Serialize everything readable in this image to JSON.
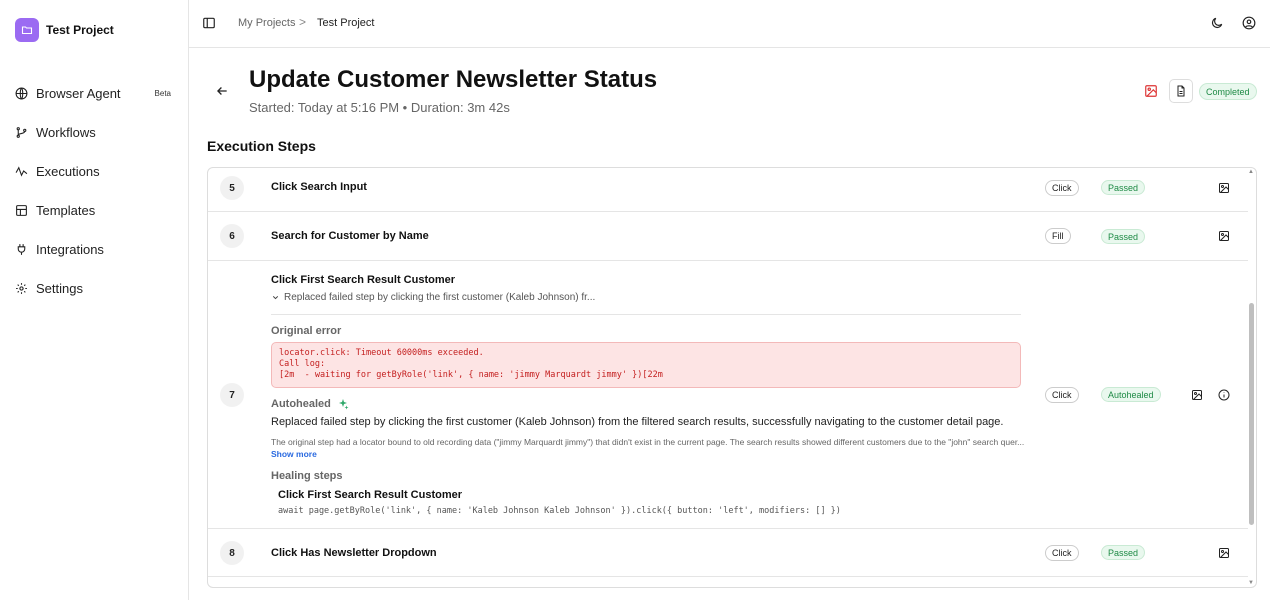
{
  "project": {
    "name": "Test Project"
  },
  "sidebar": {
    "items": [
      {
        "label": "Browser Agent",
        "icon": "globe-icon",
        "badge": "Beta"
      },
      {
        "label": "Workflows",
        "icon": "workflow-icon"
      },
      {
        "label": "Executions",
        "icon": "activity-icon"
      },
      {
        "label": "Templates",
        "icon": "template-icon"
      },
      {
        "label": "Integrations",
        "icon": "plug-icon"
      },
      {
        "label": "Settings",
        "icon": "gear-icon"
      }
    ]
  },
  "breadcrumb": {
    "parent": "My Projects",
    "separator": ">",
    "current": "Test Project"
  },
  "header": {
    "title": "Update Customer Newsletter Status",
    "meta": "Started: Today at 5:16 PM • Duration: 3m 42s",
    "status": "Completed"
  },
  "section_title": "Execution Steps",
  "steps": [
    {
      "number": "5",
      "title": "Click Search Input",
      "action": "Click",
      "status": "Passed"
    },
    {
      "number": "6",
      "title": "Search for Customer by Name",
      "action": "Fill",
      "status": "Passed"
    },
    {
      "number": "7",
      "title": "Click First Search Result Customer",
      "summary": "Replaced failed step by clicking the first customer (Kaleb Johnson) fr...",
      "action": "Click",
      "status": "Autohealed",
      "original_error_label": "Original error",
      "error_lines": "locator.click: Timeout 60000ms exceeded.\nCall log:\n\u001b[2m  - waiting for getByRole('link', { name: 'jimmy Marquardt jimmy' })\u001b[22m",
      "autohealed_label": "Autohealed",
      "heal_description": "Replaced failed step by clicking the first customer (Kaleb Johnson) from the filtered search results, successfully navigating to the customer detail page.",
      "heal_detail": "The original step had a locator bound to old recording data (\"jimmy Marquardt jimmy\") that didn't exist in the current page. The search results showed different customers due to the \"john\" search quer...",
      "show_more": "Show more",
      "healing_steps_label": "Healing steps",
      "healing_step_title": "Click First Search Result Customer",
      "healing_step_code": "await page.getByRole('link', { name: 'Kaleb Johnson Kaleb Johnson' }).click({ button: 'left', modifiers: [] })"
    },
    {
      "number": "8",
      "title": "Click Has Newsletter Dropdown",
      "action": "Click",
      "status": "Passed"
    }
  ]
}
